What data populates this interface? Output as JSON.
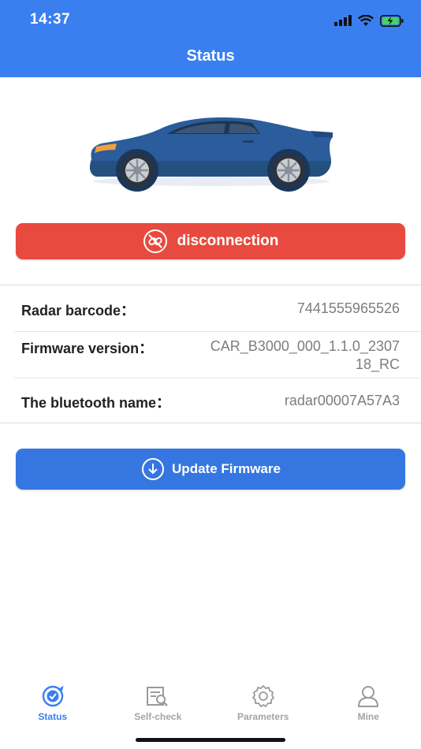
{
  "status_bar": {
    "time": "14:37"
  },
  "header": {
    "title": "Status"
  },
  "connection": {
    "button_label": "disconnection"
  },
  "info": [
    {
      "label": "Radar barcode：",
      "value": "7441555965526"
    },
    {
      "label": "Firmware version：",
      "value_line1": "CAR_B3000_000_1.1.0_2307",
      "value_line2": "18_RC"
    },
    {
      "label": "The bluetooth name：",
      "value": "radar00007A57A3"
    }
  ],
  "update": {
    "button_label": "Update Firmware"
  },
  "tabs": [
    {
      "label": "Status",
      "icon": "status-icon",
      "active": true
    },
    {
      "label": "Self-check",
      "icon": "self-check-icon",
      "active": false
    },
    {
      "label": "Parameters",
      "icon": "gear-icon",
      "active": false
    },
    {
      "label": "Mine",
      "icon": "user-icon",
      "active": false
    }
  ],
  "colors": {
    "primary": "#3a7ff0",
    "danger": "#e84a3f",
    "inactive": "#a4a4a4"
  }
}
